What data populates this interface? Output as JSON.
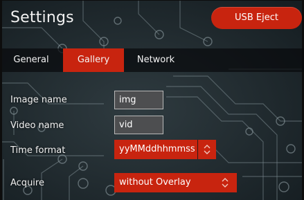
{
  "header": {
    "title": "Settings",
    "usb_eject_label": "USB Eject"
  },
  "tabs": [
    {
      "label": "General",
      "active": false
    },
    {
      "label": "Gallery",
      "active": true
    },
    {
      "label": "Network",
      "active": false
    }
  ],
  "form": {
    "image_name": {
      "label": "Image name",
      "value": "img"
    },
    "video_name": {
      "label": "Video name",
      "value": "vid"
    },
    "time_format": {
      "label": "Time format",
      "value": "yyMMddhhmmss"
    },
    "acquire": {
      "label": "Acquire",
      "value": "without Overlay"
    }
  },
  "colors": {
    "accent": "#c8240f",
    "field_bg": "#4d4e50",
    "background": "#1c262b"
  },
  "icons": {
    "select_arrow": "up-down-chevron-icon"
  }
}
